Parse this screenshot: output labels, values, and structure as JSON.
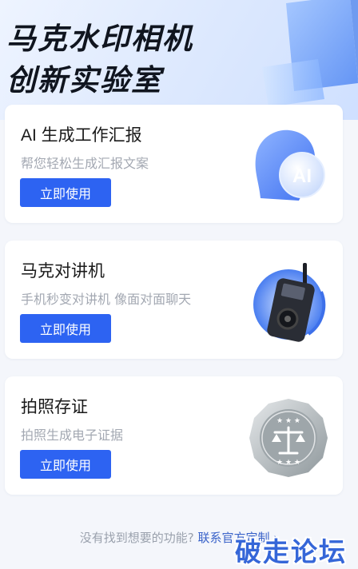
{
  "header": {
    "title_line1": "马克水印相机",
    "title_line2": "创新实验室"
  },
  "cards": [
    {
      "title": "AI 生成工作汇报",
      "subtitle": "帮您轻松生成汇报文案",
      "button": "立即使用",
      "icon": "ai-head-icon",
      "icon_text": "AI"
    },
    {
      "title": "马克对讲机",
      "subtitle": "手机秒变对讲机 像面对面聊天",
      "button": "立即使用",
      "icon": "walkie-talkie-icon"
    },
    {
      "title": "拍照存证",
      "subtitle": "拍照生成电子证据",
      "button": "立即使用",
      "icon": "scale-seal-icon"
    }
  ],
  "footer": {
    "question": "没有找到想要的功能?",
    "link": "联系官方定制",
    "chevron": "chevron-right-icon"
  },
  "watermark": "破走论坛",
  "colors": {
    "accent": "#2d63f2",
    "background": "#f4f6fb",
    "link": "#3a63c9"
  }
}
